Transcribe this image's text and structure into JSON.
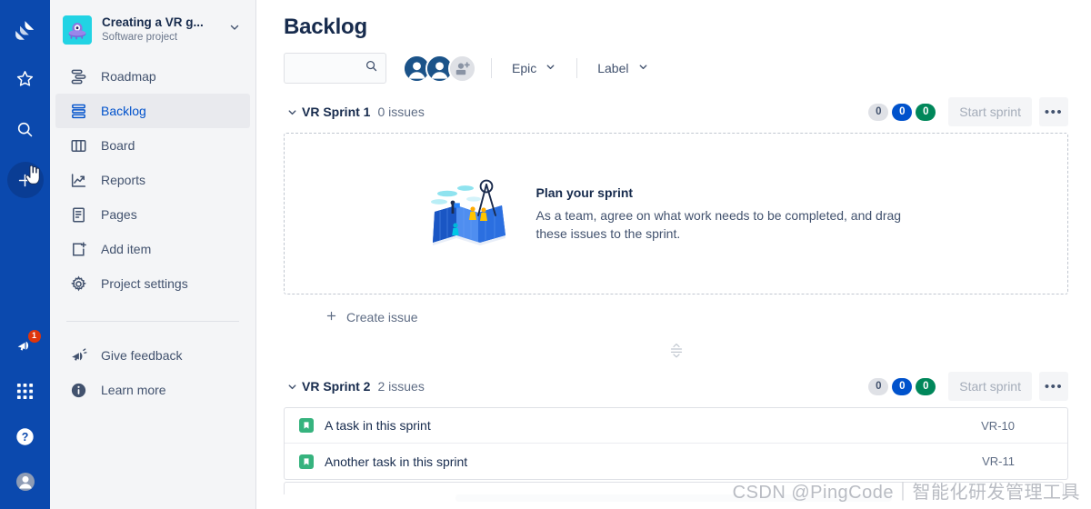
{
  "rail": {
    "logo_icon": "jira-logo-icon",
    "items": [
      {
        "icon": "star-icon",
        "name": "starred"
      },
      {
        "icon": "search-icon",
        "name": "search"
      },
      {
        "icon": "plus-icon",
        "name": "create",
        "hovered": true
      }
    ],
    "bottom": [
      {
        "icon": "megaphone-notification-icon",
        "name": "notifications",
        "badge": "1"
      },
      {
        "icon": "apps-grid-icon",
        "name": "app-switcher",
        "badge": ""
      },
      {
        "icon": "help-circle-icon",
        "name": "help",
        "badge": ""
      },
      {
        "icon": "account-avatar-icon",
        "name": "your-profile",
        "badge": ""
      }
    ]
  },
  "sidebar": {
    "project": {
      "name": "Creating a VR g...",
      "type": "Software project",
      "avatar_icon": "ufo-alien-icon",
      "avatar_color": "#22d3e4",
      "chevron_icon": "chevron-down-icon"
    },
    "nav": [
      {
        "label": "Roadmap",
        "icon": "roadmap-icon",
        "active": false
      },
      {
        "label": "Backlog",
        "icon": "backlog-icon",
        "active": true
      },
      {
        "label": "Board",
        "icon": "board-icon",
        "active": false
      },
      {
        "label": "Reports",
        "icon": "reports-icon",
        "active": false
      },
      {
        "label": "Pages",
        "icon": "pages-icon",
        "active": false
      },
      {
        "label": "Add item",
        "icon": "add-item-icon",
        "active": false
      },
      {
        "label": "Project settings",
        "icon": "gear-icon",
        "active": false
      }
    ],
    "footer": [
      {
        "label": "Give feedback",
        "icon": "megaphone-icon"
      },
      {
        "label": "Learn more",
        "icon": "info-circle-icon"
      }
    ]
  },
  "main": {
    "title": "Backlog",
    "search": {
      "value": "",
      "placeholder": "",
      "icon": "search-icon"
    },
    "avatar_add_label": "add-people-icon",
    "filters": [
      {
        "label": "Epic",
        "icon": "chevron-down-icon"
      },
      {
        "label": "Label",
        "icon": "chevron-down-icon"
      }
    ],
    "sprints": [
      {
        "name": "VR Sprint 1",
        "count_label": "0 issues",
        "badges": {
          "todo": "0",
          "inprogress": "0",
          "done": "0"
        },
        "start_button": "Start sprint",
        "more_button": "•••",
        "empty": {
          "heading": "Plan your sprint",
          "body": "As a team, agree on what work needs to be completed, and drag these issues to the sprint.",
          "illustration": "map-compass-illustration"
        },
        "create_issue": "Create issue",
        "issues": []
      },
      {
        "name": "VR Sprint 2",
        "count_label": "2 issues",
        "badges": {
          "todo": "0",
          "inprogress": "0",
          "done": "0"
        },
        "start_button": "Start sprint",
        "more_button": "•••",
        "issues": [
          {
            "type_icon": "task-icon",
            "type_color": "#36b37e",
            "summary": "A task in this sprint",
            "key": "VR-10"
          },
          {
            "type_icon": "task-icon",
            "type_color": "#36b37e",
            "summary": "Another task in this sprint",
            "key": "VR-11"
          }
        ]
      }
    ]
  },
  "watermark": "CSDN @PingCode｜智能化研发管理工具"
}
